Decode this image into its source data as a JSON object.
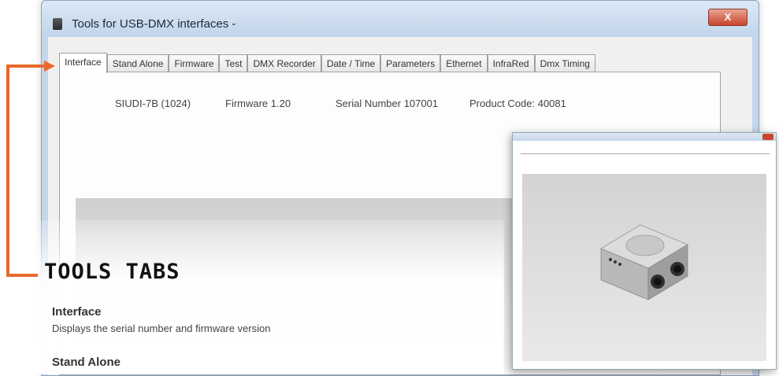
{
  "window": {
    "title": "Tools for USB-DMX interfaces -",
    "close_label": "X"
  },
  "tabs": [
    {
      "label": "Interface",
      "active": true
    },
    {
      "label": "Stand Alone"
    },
    {
      "label": "Firmware"
    },
    {
      "label": "Test"
    },
    {
      "label": "DMX Recorder"
    },
    {
      "label": "Date / Time"
    },
    {
      "label": "Parameters"
    },
    {
      "label": "Ethernet"
    },
    {
      "label": "InfraRed"
    },
    {
      "label": "Dmx Timing"
    }
  ],
  "interface_info": {
    "device": "SIUDI-7B (1024)",
    "firmware": "Firmware 1.20",
    "serial": "Serial Number 107001",
    "product_code": "Product Code: 40081"
  },
  "doc": {
    "section_title": "TOOLS TABS",
    "items": [
      {
        "heading": "Interface",
        "description": "Displays the serial number and firmware version"
      },
      {
        "heading": "Stand Alone",
        "description": ""
      }
    ]
  },
  "colors": {
    "accent": "#e8692c",
    "window_frame": "#c3d6ea",
    "close_button": "#c9452d"
  },
  "icons": {
    "app": "app-icon",
    "close": "close-icon",
    "arrow": "arrow-right-icon"
  }
}
